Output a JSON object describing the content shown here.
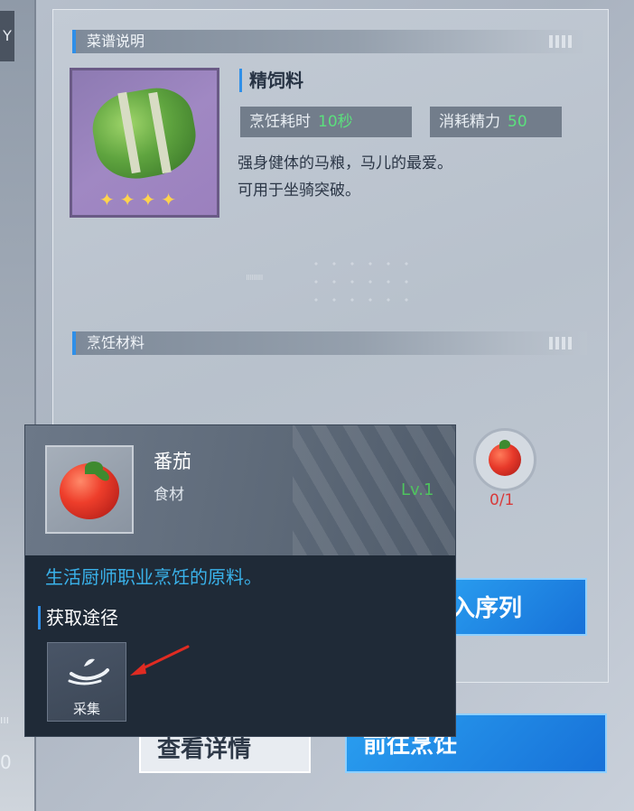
{
  "left_panel": {
    "tab_glyph": "Y",
    "bottom_text_a": "ııı",
    "bottom_text_b": "0"
  },
  "recipe_section": {
    "header": "菜谱说明",
    "name": "精饲料",
    "stars": "✦✦✦✦",
    "stats": [
      {
        "label": "烹饪耗时",
        "value": "10秒"
      },
      {
        "label": "消耗精力",
        "value": "50"
      }
    ],
    "description_lines": [
      "强身健体的马粮，马儿的最爱。",
      "可用于坐骑突破。"
    ],
    "decoration_text": "ııııııııı"
  },
  "materials_section": {
    "header": "烹饪材料",
    "ingredient_count": "0/1"
  },
  "buttons": {
    "queue": "入序列",
    "detail": "查看详情",
    "cook": "前往烹饪"
  },
  "tooltip": {
    "item_name": "番茄",
    "item_type": "食材",
    "level": "Lv.1",
    "description": "生活厨师职业烹饪的原料。",
    "source_header": "获取途径",
    "source_label": "采集"
  },
  "colors": {
    "accent_blue": "#2f8fe8",
    "level_green": "#4fc35e",
    "count_red": "#d83a3a",
    "desc_blue": "#3ab2ea"
  }
}
